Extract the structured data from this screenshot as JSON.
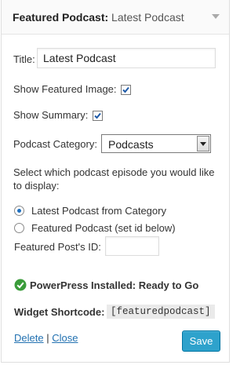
{
  "widget": {
    "title": "Featured Podcast:",
    "subtitle": "Latest Podcast"
  },
  "form": {
    "title_label": "Title:",
    "title_value": "Latest Podcast",
    "show_image_label": "Show Featured Image:",
    "show_image_checked": true,
    "show_summary_label": "Show Summary:",
    "show_summary_checked": true,
    "category_label": "Podcast Category:",
    "category_value": "Podcasts",
    "prompt": "Select which podcast episode you would like to display:",
    "radio_options": [
      {
        "label": "Latest Podcast from Category",
        "checked": true
      },
      {
        "label": "Featured Podcast (set id below)",
        "checked": false
      }
    ],
    "post_id_label": "Featured Post's ID:",
    "post_id_value": ""
  },
  "status": {
    "text": "PowerPress Installed: Ready to Go",
    "icon": "green-check-circle-icon",
    "color": "#3a9c3a"
  },
  "shortcode": {
    "label": "Widget Shortcode:",
    "value": "[featuredpodcast]"
  },
  "actions": {
    "delete": "Delete",
    "separator": "|",
    "close": "Close",
    "save": "Save"
  },
  "colors": {
    "link": "#2271b1",
    "primary_button": "#2ea2cc"
  }
}
